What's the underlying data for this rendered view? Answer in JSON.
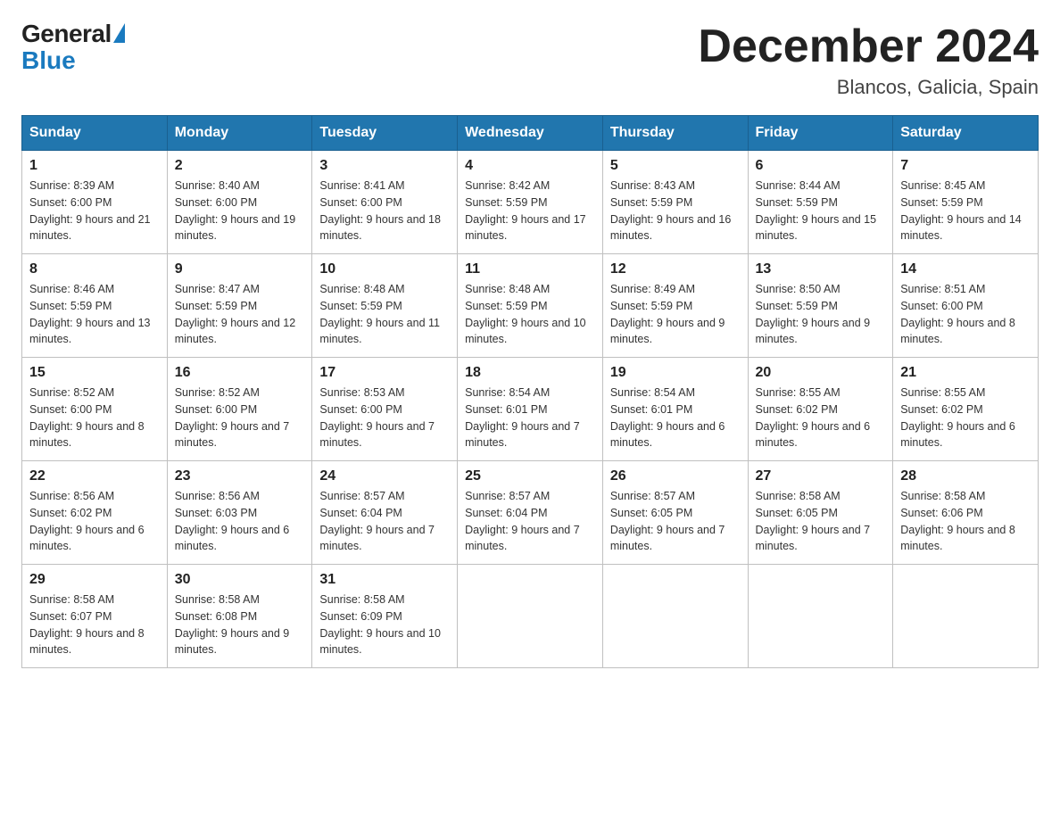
{
  "logo": {
    "general": "General",
    "blue": "Blue"
  },
  "title": "December 2024",
  "location": "Blancos, Galicia, Spain",
  "days_of_week": [
    "Sunday",
    "Monday",
    "Tuesday",
    "Wednesday",
    "Thursday",
    "Friday",
    "Saturday"
  ],
  "weeks": [
    [
      {
        "day": "1",
        "sunrise": "8:39 AM",
        "sunset": "6:00 PM",
        "daylight": "9 hours and 21 minutes."
      },
      {
        "day": "2",
        "sunrise": "8:40 AM",
        "sunset": "6:00 PM",
        "daylight": "9 hours and 19 minutes."
      },
      {
        "day": "3",
        "sunrise": "8:41 AM",
        "sunset": "6:00 PM",
        "daylight": "9 hours and 18 minutes."
      },
      {
        "day": "4",
        "sunrise": "8:42 AM",
        "sunset": "5:59 PM",
        "daylight": "9 hours and 17 minutes."
      },
      {
        "day": "5",
        "sunrise": "8:43 AM",
        "sunset": "5:59 PM",
        "daylight": "9 hours and 16 minutes."
      },
      {
        "day": "6",
        "sunrise": "8:44 AM",
        "sunset": "5:59 PM",
        "daylight": "9 hours and 15 minutes."
      },
      {
        "day": "7",
        "sunrise": "8:45 AM",
        "sunset": "5:59 PM",
        "daylight": "9 hours and 14 minutes."
      }
    ],
    [
      {
        "day": "8",
        "sunrise": "8:46 AM",
        "sunset": "5:59 PM",
        "daylight": "9 hours and 13 minutes."
      },
      {
        "day": "9",
        "sunrise": "8:47 AM",
        "sunset": "5:59 PM",
        "daylight": "9 hours and 12 minutes."
      },
      {
        "day": "10",
        "sunrise": "8:48 AM",
        "sunset": "5:59 PM",
        "daylight": "9 hours and 11 minutes."
      },
      {
        "day": "11",
        "sunrise": "8:48 AM",
        "sunset": "5:59 PM",
        "daylight": "9 hours and 10 minutes."
      },
      {
        "day": "12",
        "sunrise": "8:49 AM",
        "sunset": "5:59 PM",
        "daylight": "9 hours and 9 minutes."
      },
      {
        "day": "13",
        "sunrise": "8:50 AM",
        "sunset": "5:59 PM",
        "daylight": "9 hours and 9 minutes."
      },
      {
        "day": "14",
        "sunrise": "8:51 AM",
        "sunset": "6:00 PM",
        "daylight": "9 hours and 8 minutes."
      }
    ],
    [
      {
        "day": "15",
        "sunrise": "8:52 AM",
        "sunset": "6:00 PM",
        "daylight": "9 hours and 8 minutes."
      },
      {
        "day": "16",
        "sunrise": "8:52 AM",
        "sunset": "6:00 PM",
        "daylight": "9 hours and 7 minutes."
      },
      {
        "day": "17",
        "sunrise": "8:53 AM",
        "sunset": "6:00 PM",
        "daylight": "9 hours and 7 minutes."
      },
      {
        "day": "18",
        "sunrise": "8:54 AM",
        "sunset": "6:01 PM",
        "daylight": "9 hours and 7 minutes."
      },
      {
        "day": "19",
        "sunrise": "8:54 AM",
        "sunset": "6:01 PM",
        "daylight": "9 hours and 6 minutes."
      },
      {
        "day": "20",
        "sunrise": "8:55 AM",
        "sunset": "6:02 PM",
        "daylight": "9 hours and 6 minutes."
      },
      {
        "day": "21",
        "sunrise": "8:55 AM",
        "sunset": "6:02 PM",
        "daylight": "9 hours and 6 minutes."
      }
    ],
    [
      {
        "day": "22",
        "sunrise": "8:56 AM",
        "sunset": "6:02 PM",
        "daylight": "9 hours and 6 minutes."
      },
      {
        "day": "23",
        "sunrise": "8:56 AM",
        "sunset": "6:03 PM",
        "daylight": "9 hours and 6 minutes."
      },
      {
        "day": "24",
        "sunrise": "8:57 AM",
        "sunset": "6:04 PM",
        "daylight": "9 hours and 7 minutes."
      },
      {
        "day": "25",
        "sunrise": "8:57 AM",
        "sunset": "6:04 PM",
        "daylight": "9 hours and 7 minutes."
      },
      {
        "day": "26",
        "sunrise": "8:57 AM",
        "sunset": "6:05 PM",
        "daylight": "9 hours and 7 minutes."
      },
      {
        "day": "27",
        "sunrise": "8:58 AM",
        "sunset": "6:05 PM",
        "daylight": "9 hours and 7 minutes."
      },
      {
        "day": "28",
        "sunrise": "8:58 AM",
        "sunset": "6:06 PM",
        "daylight": "9 hours and 8 minutes."
      }
    ],
    [
      {
        "day": "29",
        "sunrise": "8:58 AM",
        "sunset": "6:07 PM",
        "daylight": "9 hours and 8 minutes."
      },
      {
        "day": "30",
        "sunrise": "8:58 AM",
        "sunset": "6:08 PM",
        "daylight": "9 hours and 9 minutes."
      },
      {
        "day": "31",
        "sunrise": "8:58 AM",
        "sunset": "6:09 PM",
        "daylight": "9 hours and 10 minutes."
      },
      null,
      null,
      null,
      null
    ]
  ]
}
